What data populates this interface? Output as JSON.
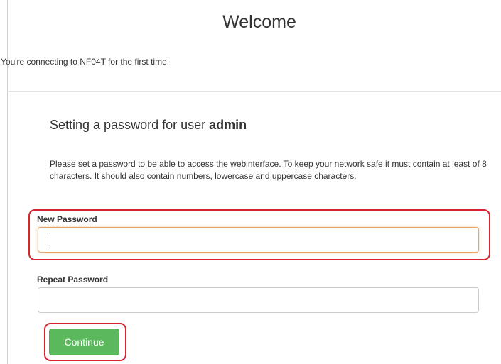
{
  "welcome": {
    "title": "Welcome",
    "intro": "You're connecting to NF04T for the first time."
  },
  "setup": {
    "heading_prefix": "Setting a password for user ",
    "heading_user": "admin",
    "description": "Please set a password to be able to access the webinterface. To keep your network safe it must contain at least of 8 characters. It should also contain numbers, lowercase and uppercase characters."
  },
  "form": {
    "new_password_label": "New Password",
    "new_password_value": "",
    "repeat_password_label": "Repeat Password",
    "repeat_password_value": "",
    "continue_label": "Continue"
  },
  "colors": {
    "highlight": "#d9232e",
    "button": "#5cb85c",
    "focus_border": "#e6a668"
  }
}
